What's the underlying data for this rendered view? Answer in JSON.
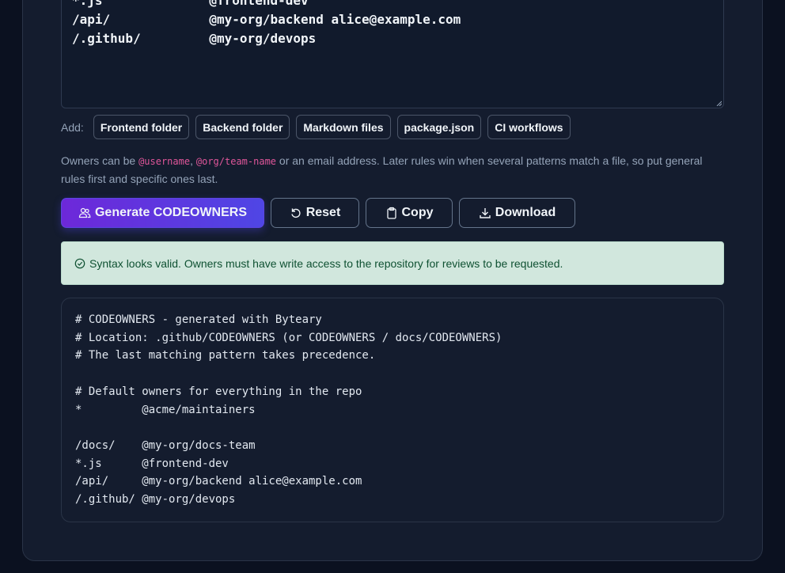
{
  "editor": {
    "lines": [
      "*.js              @frontend-dev",
      "/api/             @my-org/backend alice@example.com",
      "/.github/         @my-org/devops"
    ]
  },
  "add_row": {
    "label": "Add:",
    "chips": [
      "Frontend folder",
      "Backend folder",
      "Markdown files",
      "package.json",
      "CI workflows"
    ]
  },
  "help": {
    "prefix": "Owners can be ",
    "username": "@username",
    "sep": ", ",
    "team": "@org/team-name",
    "suffix": " or an email address. Later rules win when several patterns match a file, so put general rules first and specific ones last."
  },
  "actions": {
    "generate": "Generate CODEOWNERS",
    "reset": "Reset",
    "copy": "Copy",
    "download": "Download"
  },
  "status": {
    "text": "Syntax looks valid. Owners must have write access to the repository for reviews to be requested.",
    "color": "#d1e7dd"
  },
  "output": {
    "lines": [
      "# CODEOWNERS - generated with Byteary",
      "# Location: .github/CODEOWNERS (or CODEOWNERS / docs/CODEOWNERS)",
      "# The last matching pattern takes precedence.",
      "",
      "# Default owners for everything in the repo",
      "*         @acme/maintainers",
      "",
      "/docs/    @my-org/docs-team",
      "*.js      @frontend-dev",
      "/api/     @my-org/backend alice@example.com",
      "/.github/ @my-org/devops"
    ]
  }
}
